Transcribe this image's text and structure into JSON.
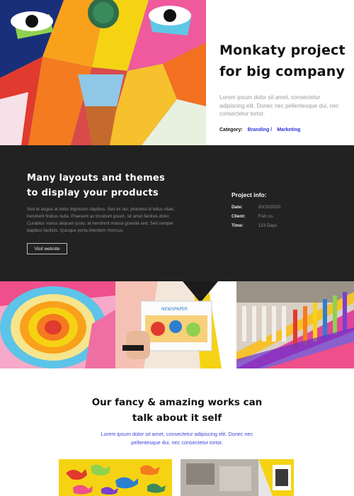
{
  "hero": {
    "image": "colorful-mural-face",
    "title_line1": "Monkaty project",
    "title_line2": "for big company",
    "description": "Lorem ipsum dolor sit amet, consectetur adipiscing elit. Donec nec pellentesque dui, nec consectetur tortor.",
    "category_label": "Category:",
    "category_links": [
      "Branding /",
      "Marketing"
    ]
  },
  "showcase": {
    "title_line1": "Many layouts and themes",
    "title_line2": "to display your products",
    "body": "Sed et augue at dolor dignissim dapibus. Sed ex dui, pharetra id tellus vitae, hendrerit finibus nulla. Praesent ac tincidunt ipsum, sit amet facilisis dolor. Curabitur varius aliquam justo, at hendrerit massa gravida sed. Sed semper dapibus facilisis. Quisque porta interdum rhoncus.",
    "button_label": "Visit website",
    "info": {
      "title": "Project info:",
      "rows": [
        {
          "key": "Date:",
          "value": "20/10/2020"
        },
        {
          "key": "Client:",
          "value": "Fish co."
        },
        {
          "key": "Time:",
          "value": "123 Days"
        }
      ]
    }
  },
  "gallery": {
    "images": [
      "concentric-color-mural",
      "hand-holding-newspaper",
      "colorful-balusters"
    ],
    "newspaper_caption": "NEWSPAPER"
  },
  "works": {
    "title_line1": "Our fancy & amazing works can",
    "title_line2": "talk about it self",
    "description": "Lorem ipsum dolor sit amet, consectetur adipiscing elit. Donec nec pellentesque dui, nec consectetur tortor.",
    "cards": [
      "toy-dinosaurs-on-yellow",
      "street-photo-with-yellow-frame"
    ]
  },
  "colors": {
    "accent": "#2b33d8",
    "dark_band": "#222222",
    "muted_text": "#9a9aa2"
  }
}
